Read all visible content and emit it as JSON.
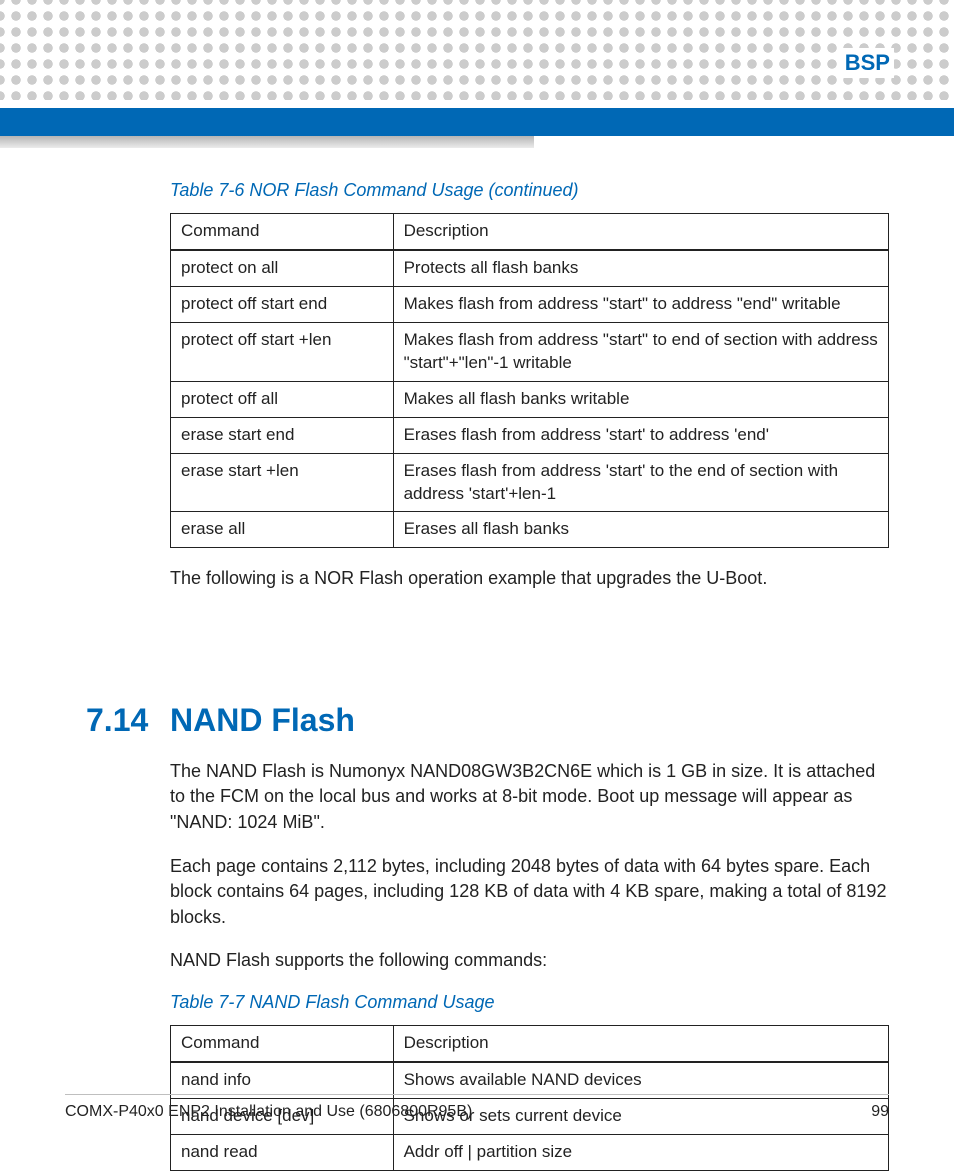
{
  "header": {
    "label": "BSP"
  },
  "table1": {
    "caption": "Table 7-6 NOR Flash Command Usage  (continued)",
    "headers": [
      "Command",
      "Description"
    ],
    "rows": [
      [
        "protect on  all",
        "Protects all flash banks"
      ],
      [
        "protect off start end",
        "Makes flash from address \"start\" to address \"end\" writable"
      ],
      [
        "protect off start +len",
        "Makes flash from address \"start\" to end of section with address \"start\"+\"len\"-1 writable"
      ],
      [
        "protect off all",
        "Makes all flash banks writable"
      ],
      [
        "erase start end",
        "Erases flash from address 'start' to address 'end'"
      ],
      [
        "erase start +len",
        "Erases flash from address 'start' to the end of section with address 'start'+len-1"
      ],
      [
        "erase all",
        "Erases all flash banks"
      ]
    ]
  },
  "para1": "The following is a NOR Flash operation example that upgrades the U-Boot.",
  "section": {
    "number": "7.14",
    "title": "NAND Flash",
    "p1": "The NAND Flash is Numonyx NAND08GW3B2CN6E which is 1 GB in size. It is attached to the FCM on the local bus and works at 8-bit mode. Boot up message will appear as \"NAND: 1024 MiB\".",
    "p2": "Each page contains 2,112 bytes, including 2048 bytes of data with 64 bytes spare. Each block contains 64 pages, including 128 KB of data with 4 KB spare, making a total of 8192 blocks.",
    "p3": "NAND Flash supports the following commands:"
  },
  "table2": {
    "caption": "Table 7-7 NAND Flash Command Usage",
    "headers": [
      "Command",
      "Description"
    ],
    "rows": [
      [
        "nand info",
        "Shows available NAND devices"
      ],
      [
        "nand device [dev]",
        "Shows or sets current device"
      ],
      [
        "nand read",
        "Addr off | partition size"
      ]
    ]
  },
  "footer": {
    "left": "COMX-P40x0 ENP2 Installation and Use (6806800R95B)",
    "right": "99"
  }
}
